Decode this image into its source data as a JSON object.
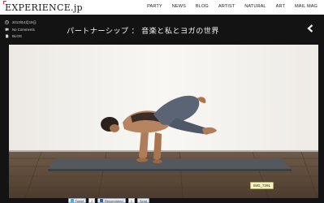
{
  "site": {
    "logo_text": "EXPERIENCE.jp",
    "brand_color": "#e0202e"
  },
  "nav": [
    {
      "label": "PARTY"
    },
    {
      "label": "NEWS"
    },
    {
      "label": "BLOG"
    },
    {
      "label": "ARTIST"
    },
    {
      "label": "NATURAL"
    },
    {
      "label": "ART"
    },
    {
      "label": "MAIL MAG"
    }
  ],
  "post": {
    "date": "2013年4月19日",
    "comments": "No Comments",
    "category": "BLOG",
    "title": "パートナーシップ ： 音楽と私とヨガの世界",
    "image_label": "IMG_7291"
  },
  "share": {
    "tweet_label": "Tweet",
    "tweet_count": "2",
    "recommend_label": "Recommend",
    "recommend_count": "0",
    "send_label": "Send"
  },
  "icons": {
    "date": "clock-icon",
    "comments": "speech-bubble-icon",
    "category": "document-icon",
    "back": "chevron-left-icon"
  }
}
